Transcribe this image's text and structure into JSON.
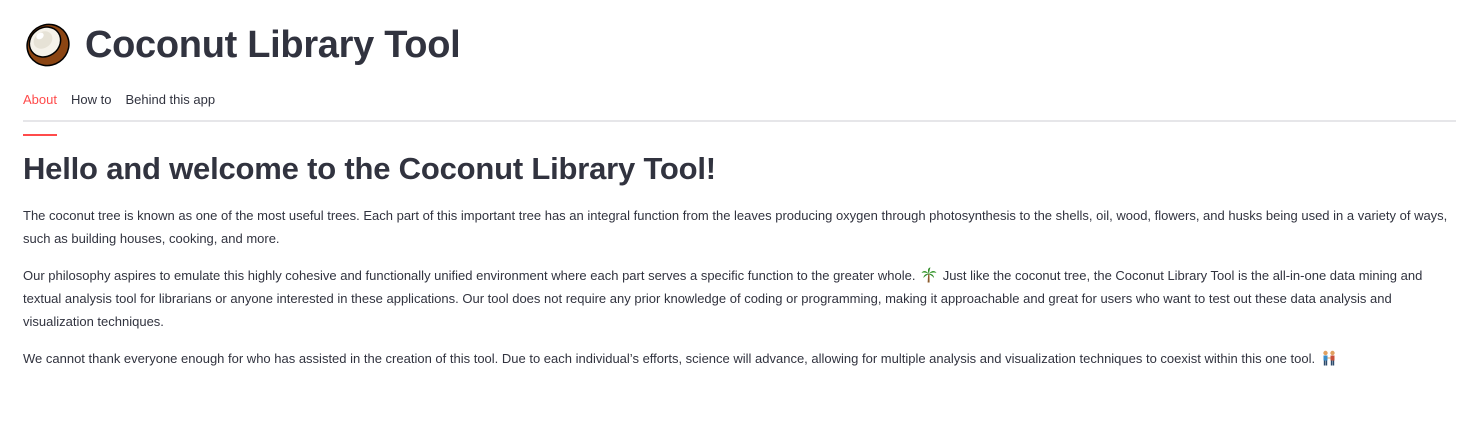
{
  "app": {
    "title": "Coconut Library Tool",
    "logo_icon": "coconut-icon"
  },
  "tabs": [
    {
      "label": "About",
      "active": true
    },
    {
      "label": "How to",
      "active": false
    },
    {
      "label": "Behind this app",
      "active": false
    }
  ],
  "about": {
    "heading": "Hello and welcome to the Coconut Library Tool!",
    "para1": "The coconut tree is known as one of the most useful trees. Each part of this important tree has an integral function from the leaves producing oxygen through photosynthesis to the shells, oil, wood, flowers, and husks being used in a variety of ways, such as building houses, cooking, and more.",
    "para2_before": "Our philosophy aspires to emulate this highly cohesive and functionally unified environment where each part serves a specific function to the greater whole.",
    "para2_icon": "palm-tree-icon",
    "para2_after": "Just like the coconut tree, the Coconut Library Tool is the all-in-one data mining and textual analysis tool for librarians or anyone interested in these applications. Our tool does not require any prior knowledge of coding or programming, making it approachable and great for users who want to test out these data analysis and visualization techniques.",
    "para3": "We cannot thank everyone enough for who has assisted in the creation of this tool. Due to each individual’s efforts, science will advance, allowing for multiple analysis and visualization techniques to coexist within this one tool.",
    "para3_icon": "people-holding-hands-icon"
  },
  "colors": {
    "accent": "#ff4b4b",
    "text": "#31333f",
    "divider": "#e6e6e9"
  }
}
